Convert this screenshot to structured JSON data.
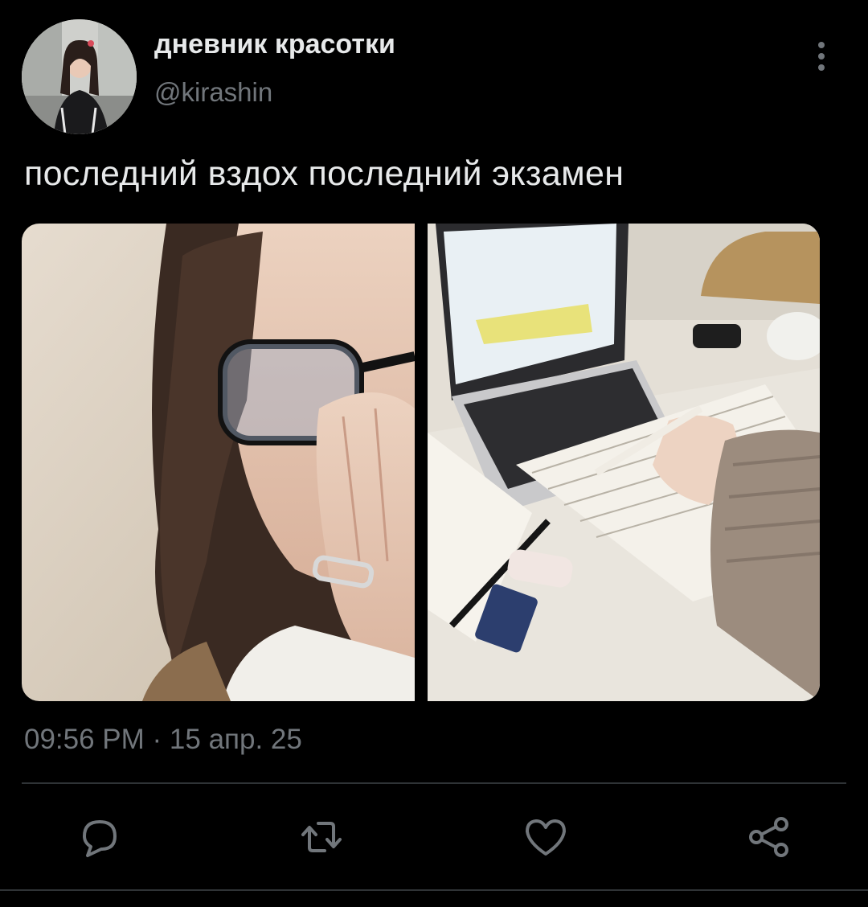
{
  "tweet": {
    "author": {
      "display_name": "дневник красотки",
      "handle": "@kirashin",
      "avatar_icon": "profile-photo"
    },
    "text": "последний вздох последний экзамен",
    "timestamp": "09:56 PM · 15 апр. 25",
    "media": [
      {
        "kind": "photo",
        "depicts": "person-with-glasses-covering-face"
      },
      {
        "kind": "photo",
        "depicts": "laptop-and-notebook-study-desk"
      }
    ],
    "actions": {
      "reply_icon": "reply-icon",
      "retweet_icon": "retweet-icon",
      "like_icon": "heart-icon",
      "share_icon": "share-icon",
      "more_icon": "more-vertical-icon"
    }
  },
  "theme": {
    "background": "#000000",
    "text_primary": "#e7e9ea",
    "text_secondary": "#71767b",
    "divider": "#2f3336"
  }
}
